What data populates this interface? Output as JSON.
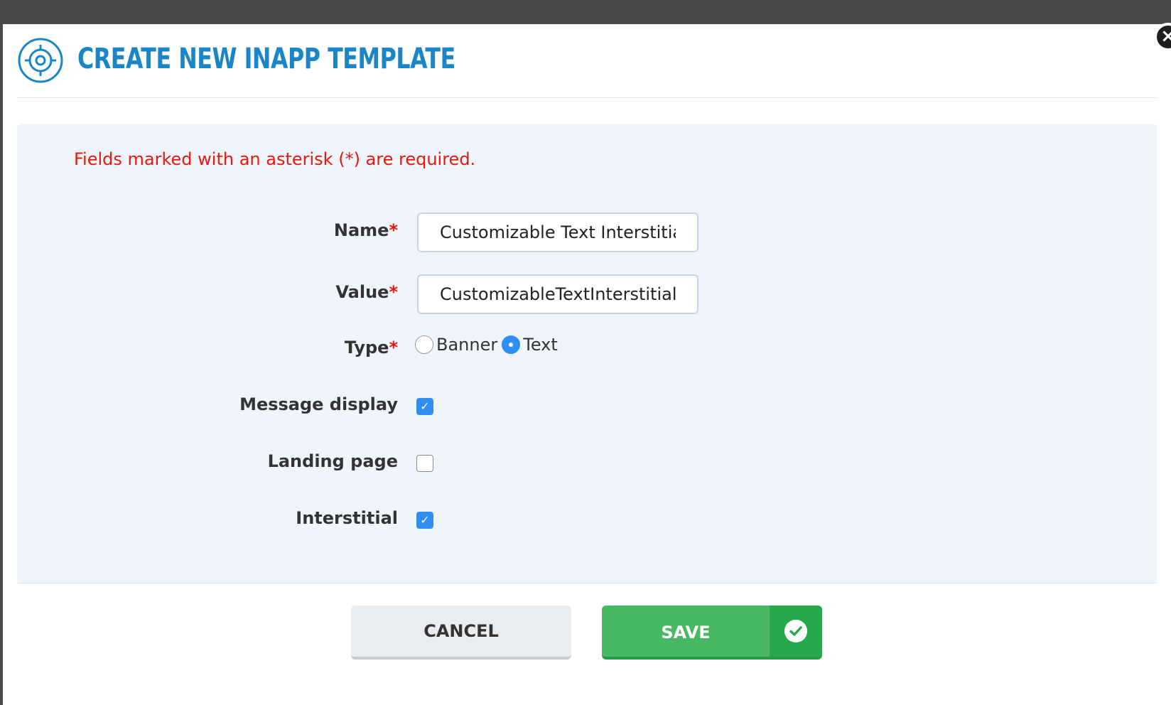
{
  "dialog": {
    "title": "CREATE NEW INAPP TEMPLATE",
    "close_icon": "close-icon",
    "header_icon": "target-icon"
  },
  "form": {
    "required_note": "Fields marked with an asterisk (*) are required.",
    "asterisk": "*",
    "name": {
      "label": "Name",
      "value": "Customizable Text Interstitial"
    },
    "value": {
      "label": "Value",
      "value": "CustomizableTextInterstitial"
    },
    "type": {
      "label": "Type",
      "options": [
        {
          "label": "Banner",
          "checked": false
        },
        {
          "label": "Text",
          "checked": true
        }
      ]
    },
    "message_display": {
      "label": "Message display",
      "checked": true
    },
    "landing_page": {
      "label": "Landing page",
      "checked": false
    },
    "interstitial": {
      "label": "Interstitial",
      "checked": true
    }
  },
  "buttons": {
    "cancel_label": "CANCEL",
    "save_label": "SAVE",
    "save_icon": "check-circle-icon"
  },
  "colors": {
    "title": "#1a86c7",
    "required": "#e8180c",
    "save": "#48b864",
    "checkbox": "#2f8ef2"
  }
}
